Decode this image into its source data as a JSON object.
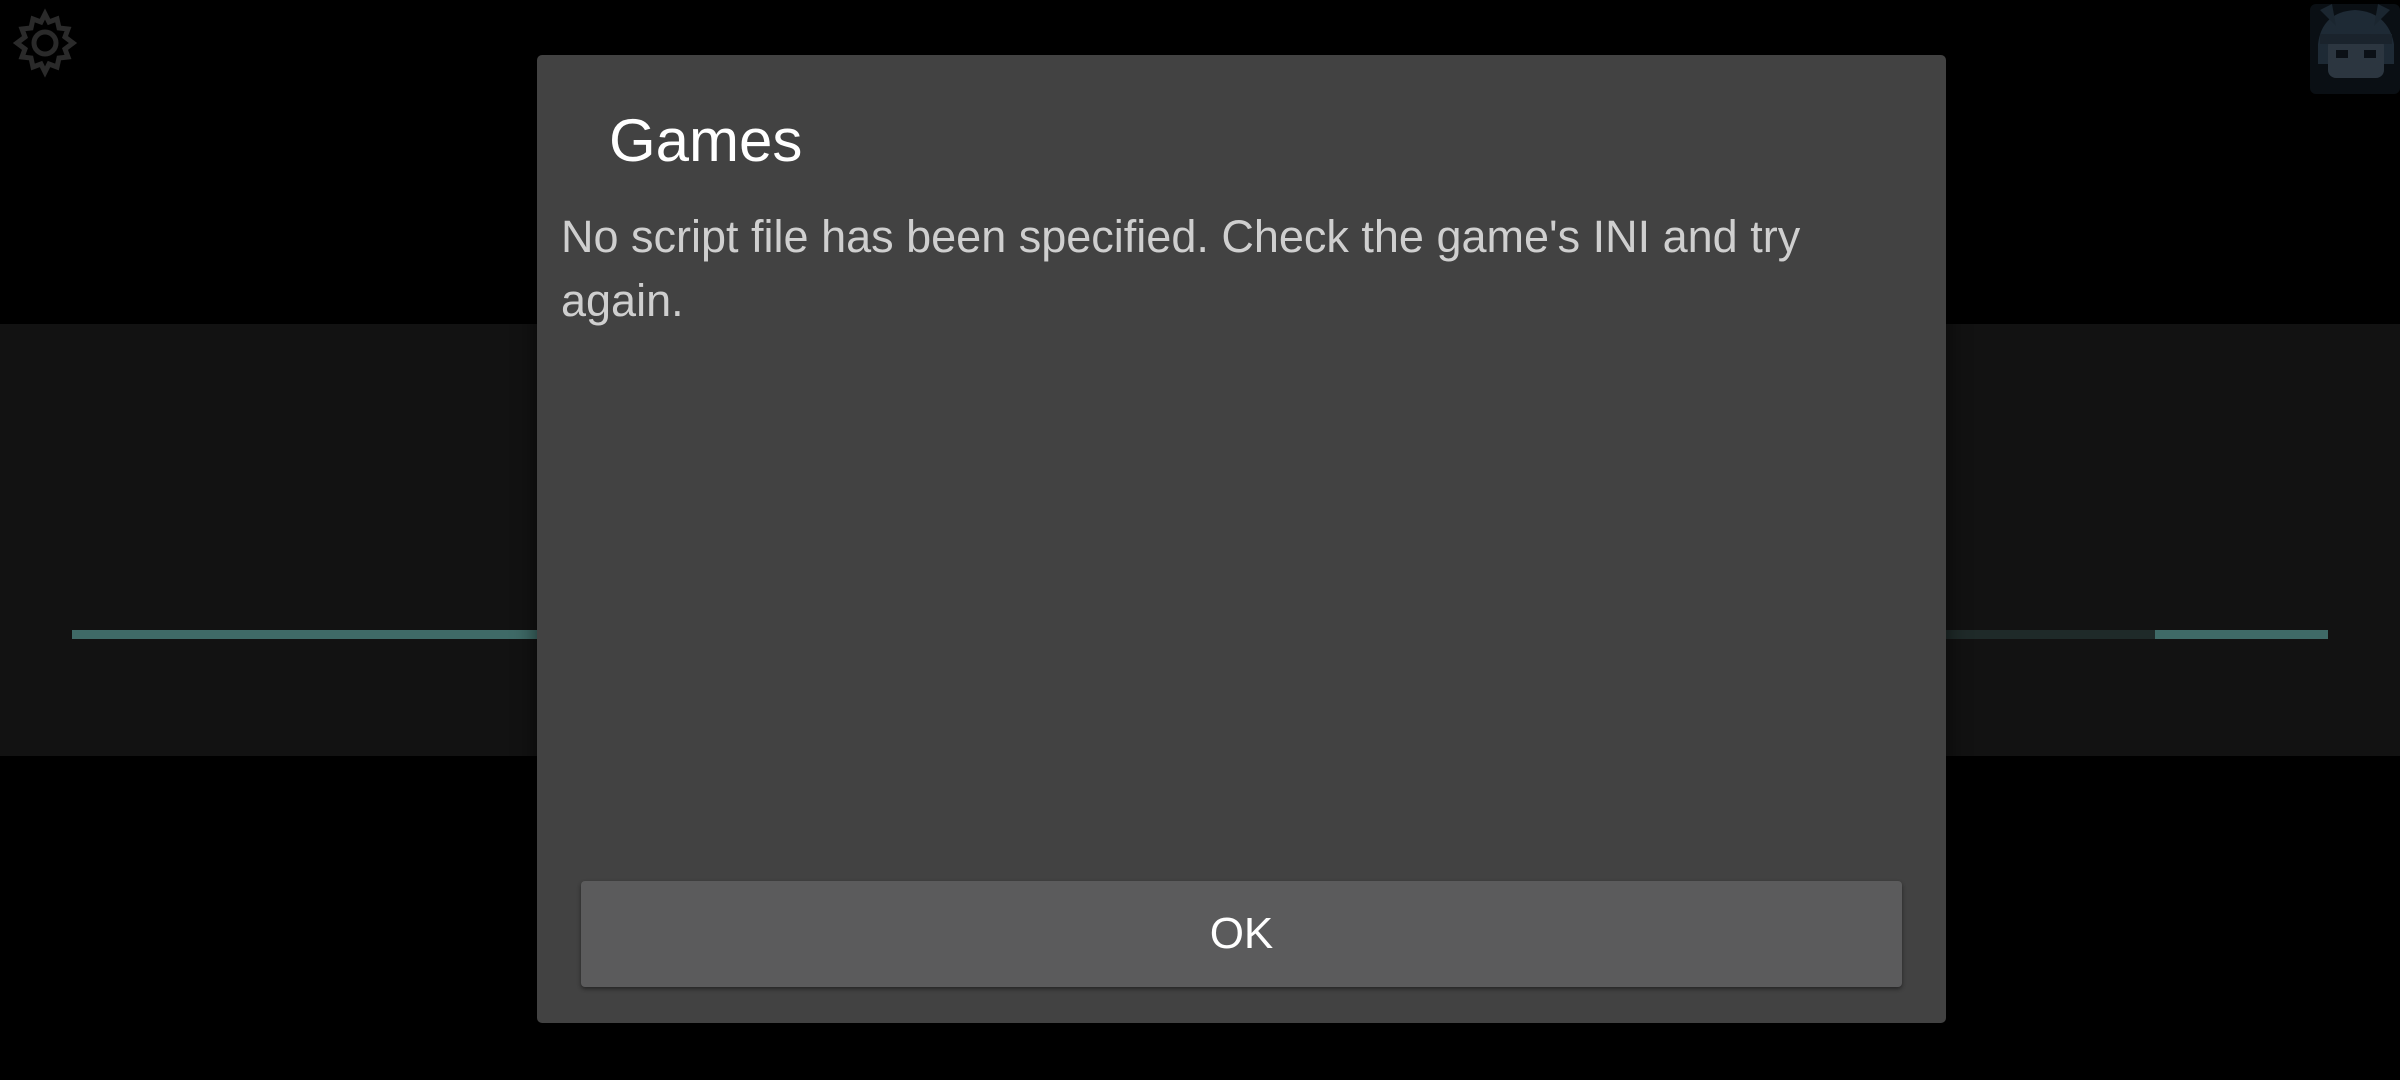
{
  "background": {
    "settings_icon": "gear-icon",
    "avatar_icon": "character-avatar-icon",
    "accent_color": "#3f6a67"
  },
  "dialog": {
    "title": "Games",
    "message": "No script file has been specified. Check the game's INI and try again.",
    "ok_label": "OK"
  }
}
